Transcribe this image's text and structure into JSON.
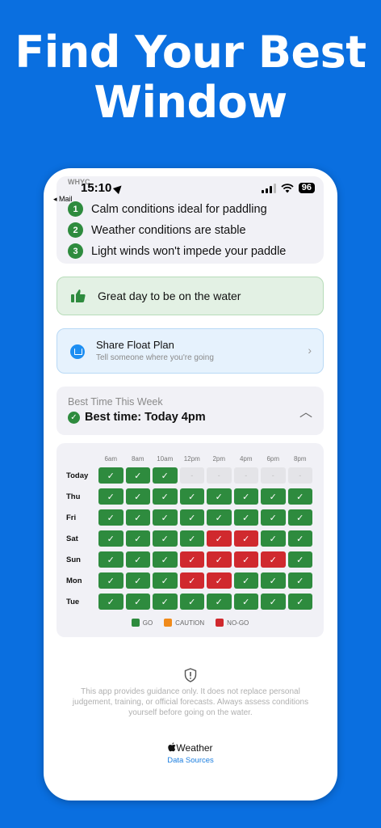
{
  "headline": {
    "line1": "Find Your Best",
    "line2": "Window"
  },
  "status_bar": {
    "time": "15:10",
    "carrier_label": "WHYC",
    "back_label": "◂ Mail",
    "battery": "96"
  },
  "reasons": [
    {
      "num": "1",
      "text": "Calm conditions ideal for paddling"
    },
    {
      "num": "2",
      "text": "Weather conditions are stable"
    },
    {
      "num": "3",
      "text": "Light winds won't impede your paddle"
    }
  ],
  "verdict": {
    "text": "Great day to be on the water",
    "icon": "thumbs-up-icon"
  },
  "share": {
    "title": "Share Float Plan",
    "subtitle": "Tell someone where you're going"
  },
  "best_time": {
    "label": "Best Time This Week",
    "value": "Best time: Today 4pm"
  },
  "schedule": {
    "hours": [
      "6am",
      "8am",
      "10am",
      "12pm",
      "2pm",
      "4pm",
      "6pm",
      "8pm"
    ],
    "rows": [
      {
        "day": "Today",
        "cells": [
          "go",
          "go",
          "go",
          "na",
          "na",
          "na",
          "na",
          "na"
        ]
      },
      {
        "day": "Thu",
        "cells": [
          "go",
          "go",
          "go",
          "go",
          "go",
          "go",
          "go",
          "go"
        ]
      },
      {
        "day": "Fri",
        "cells": [
          "go",
          "go",
          "go",
          "go",
          "go",
          "go",
          "go",
          "go"
        ]
      },
      {
        "day": "Sat",
        "cells": [
          "go",
          "go",
          "go",
          "go",
          "nogo",
          "nogo",
          "go",
          "go"
        ]
      },
      {
        "day": "Sun",
        "cells": [
          "go",
          "go",
          "go",
          "nogo",
          "nogo",
          "nogo",
          "nogo",
          "go"
        ]
      },
      {
        "day": "Mon",
        "cells": [
          "go",
          "go",
          "go",
          "nogo",
          "nogo",
          "go",
          "go",
          "go"
        ]
      },
      {
        "day": "Tue",
        "cells": [
          "go",
          "go",
          "go",
          "go",
          "go",
          "go",
          "go",
          "go"
        ]
      }
    ],
    "legend": [
      {
        "key": "go",
        "label": "GO",
        "color": "#2e8b3e"
      },
      {
        "key": "caution",
        "label": "CAUTION",
        "color": "#f08a1a"
      },
      {
        "key": "nogo",
        "label": "NO-GO",
        "color": "#d0292e"
      }
    ],
    "check_glyph": "✓",
    "na_glyph": "-"
  },
  "disclaimer": "This app provides guidance only. It does not replace personal judgement, training, or official forecasts. Always assess conditions yourself before going on the water.",
  "footer": {
    "weather_brand": "Weather",
    "data_sources": "Data Sources"
  },
  "colors": {
    "background": "#0a6fe0",
    "go": "#2e8b3e",
    "nogo": "#d0292e",
    "caution": "#f08a1a",
    "link": "#1d7fe0"
  }
}
